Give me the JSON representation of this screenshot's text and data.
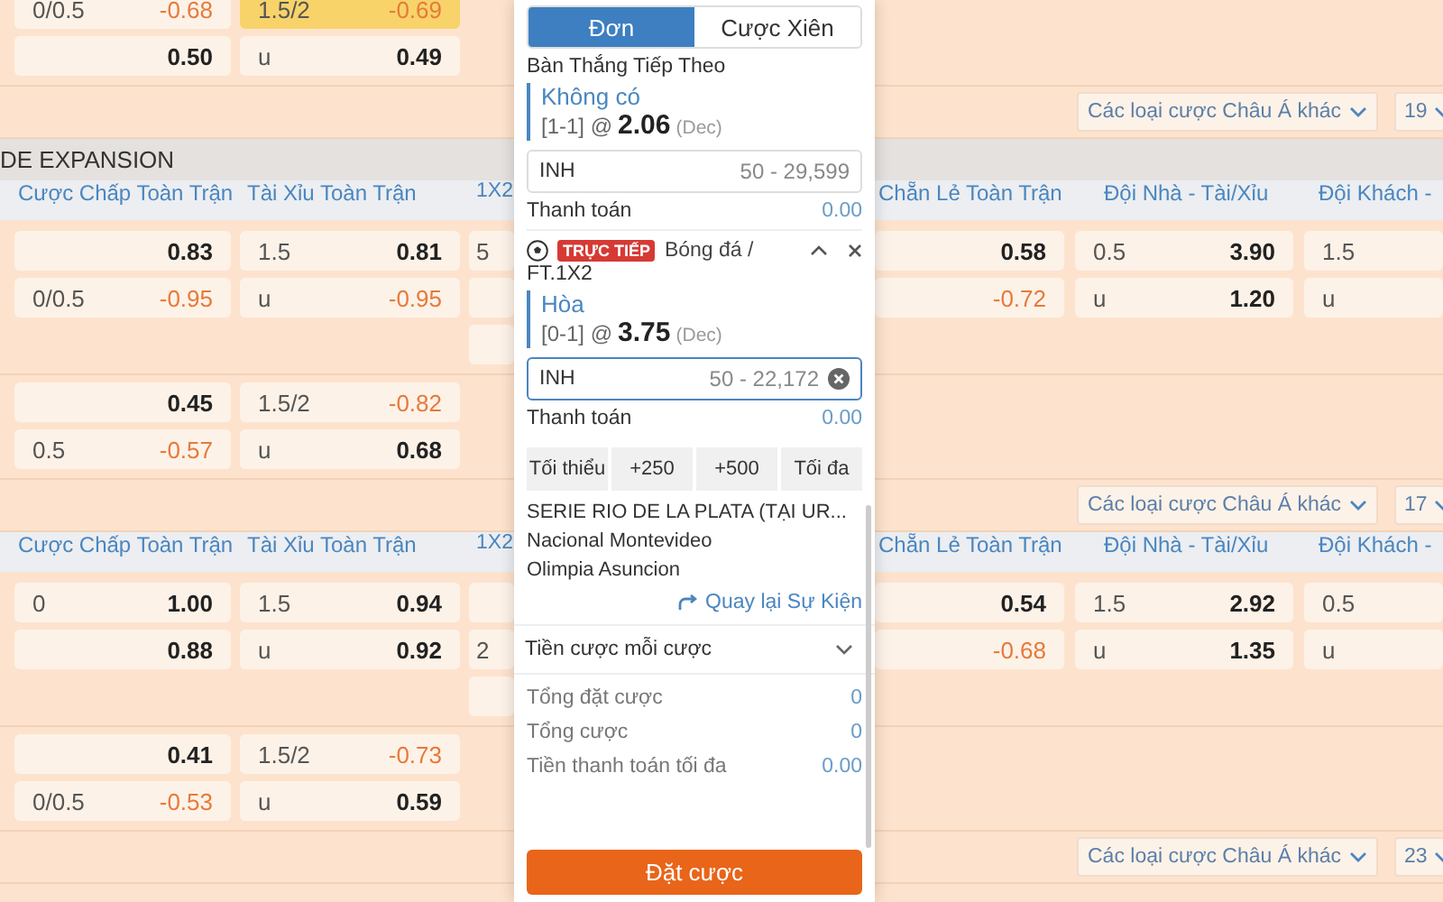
{
  "blocks": [
    {
      "kind": "match",
      "rows": [
        {
          "left": [
            {
              "line": "0/0.5",
              "odds": "-0.68",
              "negative": true,
              "selected": false
            },
            {
              "line": "1.5/2",
              "odds": "-0.69",
              "negative": true,
              "selected": true
            }
          ],
          "right": []
        },
        {
          "left": [
            {
              "odds": "0.50",
              "negative": false,
              "selected": false
            },
            {
              "line": "u",
              "odds": "0.49",
              "negative": false,
              "selected": false
            }
          ],
          "right": []
        }
      ]
    },
    {
      "kind": "toolbar",
      "filter": "Các loại cược Châu Á khác",
      "count": "19"
    },
    {
      "kind": "league",
      "name": "DE EXPANSION"
    },
    {
      "kind": "headers",
      "left": [
        "Cược Chấp Toàn Trận",
        "Tài Xỉu Toàn Trận",
        "1X2"
      ],
      "right": [
        "Chẵn Lẻ Toàn Trận",
        "Đội Nhà - Tài/Xỉu",
        "Đội Khách -"
      ]
    },
    {
      "kind": "match",
      "rows": [
        {
          "left": [
            {
              "odds": "0.83",
              "negative": false,
              "selected": false
            },
            {
              "line": "1.5",
              "odds": "0.81",
              "negative": false,
              "selected": false
            },
            {
              "line": "5",
              "selected": false
            }
          ],
          "right": [
            {
              "odds": "0.58",
              "negative": false,
              "selected": false
            },
            {
              "line": "0.5",
              "odds": "3.90",
              "negative": false,
              "selected": false
            },
            {
              "line": "1.5",
              "selected": false
            }
          ]
        },
        {
          "left": [
            {
              "line": "0/0.5",
              "odds": "-0.95",
              "negative": true,
              "selected": false
            },
            {
              "line": "u",
              "odds": "-0.95",
              "negative": true,
              "selected": false
            },
            {
              "selected": false
            }
          ],
          "right": [
            {
              "odds": "-0.72",
              "negative": true,
              "selected": false
            },
            {
              "line": "u",
              "odds": "1.20",
              "negative": false,
              "selected": false
            },
            {
              "line": "u",
              "selected": false
            }
          ]
        },
        {
          "extra": true,
          "left": [
            {
              "selected": false
            }
          ],
          "right": []
        }
      ]
    },
    {
      "kind": "match",
      "rows": [
        {
          "left": [
            {
              "odds": "0.45",
              "negative": false,
              "selected": false
            },
            {
              "line": "1.5/2",
              "odds": "-0.82",
              "negative": true,
              "selected": false
            }
          ],
          "right": []
        },
        {
          "left": [
            {
              "line": "0.5",
              "odds": "-0.57",
              "negative": true,
              "selected": false
            },
            {
              "line": "u",
              "odds": "0.68",
              "negative": false,
              "selected": false
            }
          ],
          "right": []
        }
      ]
    },
    {
      "kind": "toolbar",
      "filter": "Các loại cược Châu Á khác",
      "count": "17"
    },
    {
      "kind": "headers",
      "left": [
        "Cược Chấp Toàn Trận",
        "Tài Xỉu Toàn Trận",
        "1X2"
      ],
      "right": [
        "Chẵn Lẻ Toàn Trận",
        "Đội Nhà - Tài/Xỉu",
        "Đội Khách -"
      ]
    },
    {
      "kind": "match",
      "rows": [
        {
          "left": [
            {
              "line": "0",
              "odds": "1.00",
              "negative": false,
              "selected": false
            },
            {
              "line": "1.5",
              "odds": "0.94",
              "negative": false,
              "selected": false
            },
            {
              "selected": false
            }
          ],
          "right": [
            {
              "odds": "0.54",
              "negative": false,
              "selected": false
            },
            {
              "line": "1.5",
              "odds": "2.92",
              "negative": false,
              "selected": false
            },
            {
              "line": "0.5",
              "selected": false
            }
          ]
        },
        {
          "left": [
            {
              "odds": "0.88",
              "negative": false,
              "selected": false
            },
            {
              "line": "u",
              "odds": "0.92",
              "negative": false,
              "selected": false
            },
            {
              "line": "2",
              "selected": false
            }
          ],
          "right": [
            {
              "odds": "-0.68",
              "negative": true,
              "selected": false
            },
            {
              "line": "u",
              "odds": "1.35",
              "negative": false,
              "selected": false
            },
            {
              "line": "u",
              "selected": false
            }
          ]
        },
        {
          "extra": true,
          "left": [
            {
              "selected": false
            }
          ],
          "right": []
        }
      ]
    },
    {
      "kind": "match",
      "rows": [
        {
          "left": [
            {
              "odds": "0.41",
              "negative": false,
              "selected": false
            },
            {
              "line": "1.5/2",
              "odds": "-0.73",
              "negative": true,
              "selected": false
            }
          ],
          "right": []
        },
        {
          "left": [
            {
              "line": "0/0.5",
              "odds": "-0.53",
              "negative": true,
              "selected": false
            },
            {
              "line": "u",
              "odds": "0.59",
              "negative": false,
              "selected": false
            }
          ],
          "right": []
        }
      ]
    },
    {
      "kind": "toolbar",
      "filter": "Các loại cược Châu Á khác",
      "count": "23"
    }
  ],
  "slip": {
    "tabs": [
      {
        "label": "Đơn",
        "selected": true
      },
      {
        "label": "Cược Xiên",
        "selected": false
      }
    ],
    "bets": [
      {
        "market": "Bàn Thắng Tiếp Theo",
        "selection": "Không có",
        "score": "[1-1] @",
        "odds": "2.06",
        "format": "(Dec)",
        "stake": {
          "currency": "INH",
          "placeholder": "50 - 29,599",
          "focused": false
        },
        "payout_label": "Thanh toán",
        "payout": "0.00"
      },
      {
        "live_badge": "TRỰC TIẾP",
        "sport": "Bóng đá /",
        "market": "FT.1X2",
        "selection": "Hòa",
        "score": "[0-1] @",
        "odds": "3.75",
        "format": "(Dec)",
        "stake": {
          "currency": "INH",
          "placeholder": "50 - 22,172",
          "focused": true
        },
        "payout_label": "Thanh toán",
        "payout": "0.00"
      }
    ],
    "quick_stakes": [
      "Tối thiểu",
      "+250",
      "+500",
      "Tối đa"
    ],
    "event": {
      "league": "SERIE RIO DE LA PLATA (TẠI UR...",
      "home": "Nacional Montevideo",
      "away": "Olimpia Asuncion"
    },
    "back_link": "Quay lại Sự Kiện",
    "stake_mode": "Tiền cược mỗi cược",
    "summary": [
      {
        "label": "Tổng đặt cược",
        "value": "0"
      },
      {
        "label": "Tổng cược",
        "value": "0"
      },
      {
        "label": "Tiền thanh toán tối đa",
        "value": "0.00"
      }
    ],
    "submit": "Đặt cược"
  }
}
